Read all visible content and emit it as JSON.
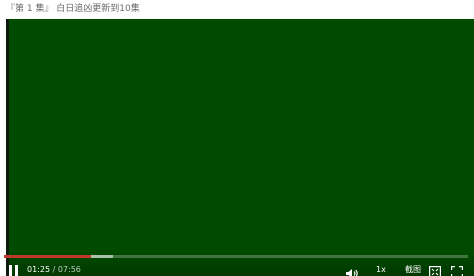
{
  "header": {
    "episode_title": "『第 1 集』 白日追凶更新到10集"
  },
  "player": {
    "background_color": "#004b00",
    "progress": {
      "played_fraction": 0.188,
      "buffered_fraction": 0.235,
      "played_color": "#c0392b"
    },
    "current_time": "01:25",
    "separator": " / ",
    "duration": "07:56",
    "speed_label": "1x",
    "screenshot_label": "截图",
    "icons": {
      "play_pause": "pause-icon",
      "volume": "volume-icon",
      "web_fullscreen": "web-fullscreen-icon",
      "fullscreen": "fullscreen-icon"
    }
  }
}
